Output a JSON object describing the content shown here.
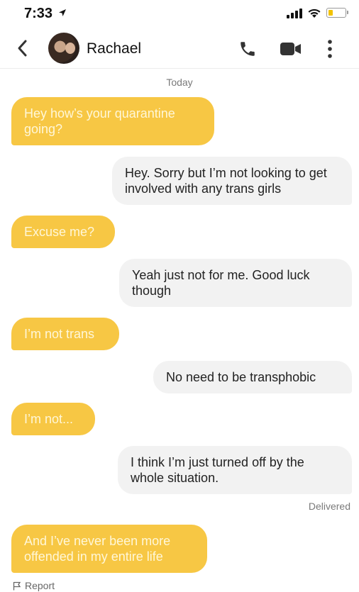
{
  "status_bar": {
    "time": "7:33",
    "battery_color": "#f2c200"
  },
  "header": {
    "contact_name": "Rachael"
  },
  "conversation": {
    "day_label": "Today",
    "messages": [
      {
        "sender": "them",
        "text": "Hey how’s your quarantine going?"
      },
      {
        "sender": "me",
        "text": "Hey. Sorry but I’m not looking to get involved with any trans girls"
      },
      {
        "sender": "them",
        "text": "Excuse me?"
      },
      {
        "sender": "me",
        "text": "Yeah just not for me. Good luck though"
      },
      {
        "sender": "them",
        "text": "I’m not trans"
      },
      {
        "sender": "me",
        "text": "No need to be transphobic"
      },
      {
        "sender": "them",
        "text": "I’m not..."
      },
      {
        "sender": "me",
        "text": "I think I’m just turned off by the whole situation."
      },
      {
        "sender": "them",
        "text": "And I’ve never been more offended in my entire life"
      }
    ],
    "delivered_label": "Delivered"
  },
  "footer": {
    "report_label": "Report"
  },
  "colors": {
    "incoming_bubble": "#f7c744",
    "outgoing_bubble": "#f2f2f2"
  }
}
